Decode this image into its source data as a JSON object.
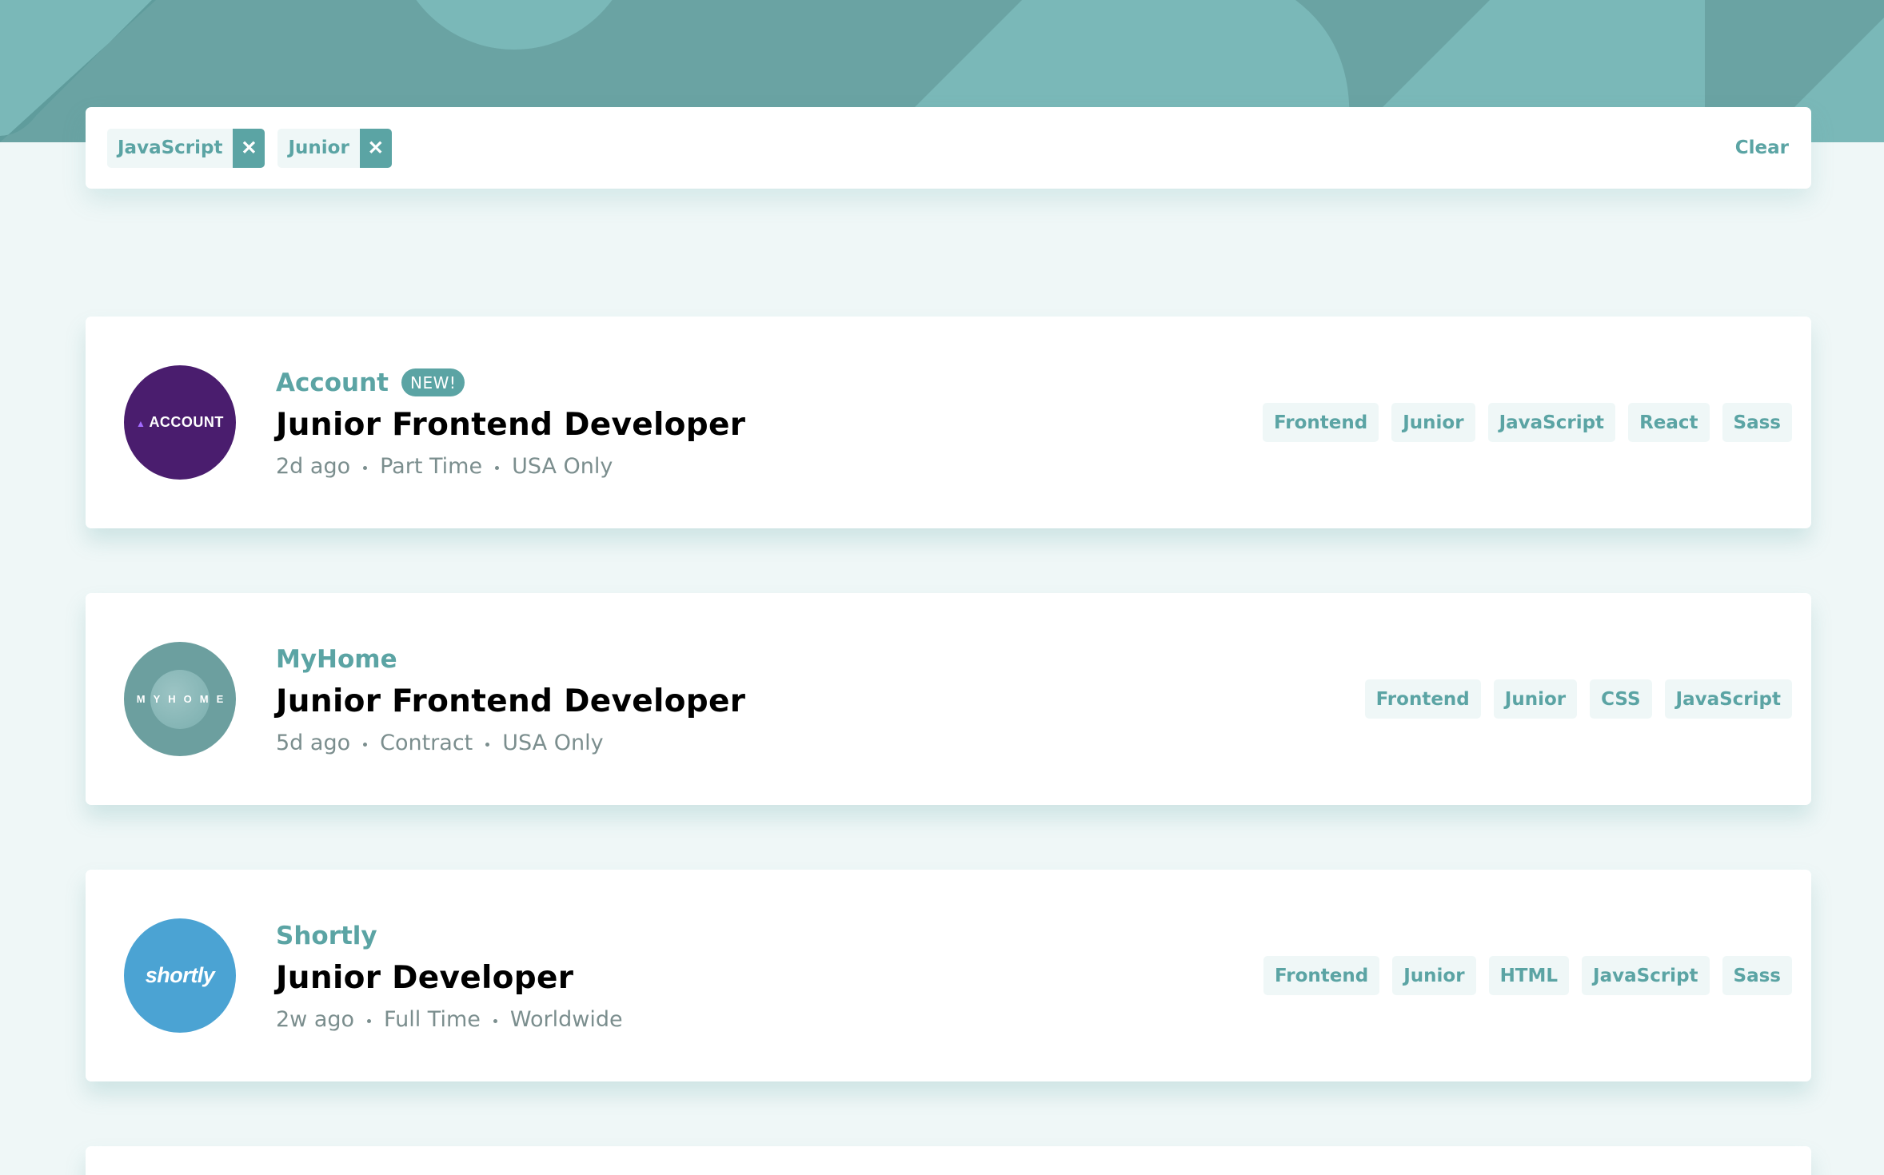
{
  "filter_bar": {
    "chips": [
      {
        "label": "JavaScript",
        "remove_icon": "close-icon"
      },
      {
        "label": "Junior",
        "remove_icon": "close-icon"
      }
    ],
    "remove_glyph": "✕",
    "clear_label": "Clear"
  },
  "jobs": [
    {
      "company": "Account",
      "logo_text": "ACCOUNT",
      "new_badge": "NEW!",
      "position": "Junior Frontend Developer",
      "posted": "2d ago",
      "contract": "Part Time",
      "location": "USA Only",
      "tags": [
        "Frontend",
        "Junior",
        "JavaScript",
        "React",
        "Sass"
      ]
    },
    {
      "company": "MyHome",
      "logo_text": "MYHOME",
      "position": "Junior Frontend Developer",
      "posted": "5d ago",
      "contract": "Contract",
      "location": "USA Only",
      "tags": [
        "Frontend",
        "Junior",
        "CSS",
        "JavaScript"
      ]
    },
    {
      "company": "Shortly",
      "logo_text": "shortly",
      "position": "Junior Developer",
      "posted": "2w ago",
      "contract": "Full Time",
      "location": "Worldwide",
      "tags": [
        "Frontend",
        "Junior",
        "HTML",
        "JavaScript",
        "Sass"
      ]
    }
  ],
  "colors": {
    "primary": "#5ba4a4",
    "background": "#eff7f7",
    "text_dark": "#000000",
    "text_muted": "#7b8e8e"
  }
}
